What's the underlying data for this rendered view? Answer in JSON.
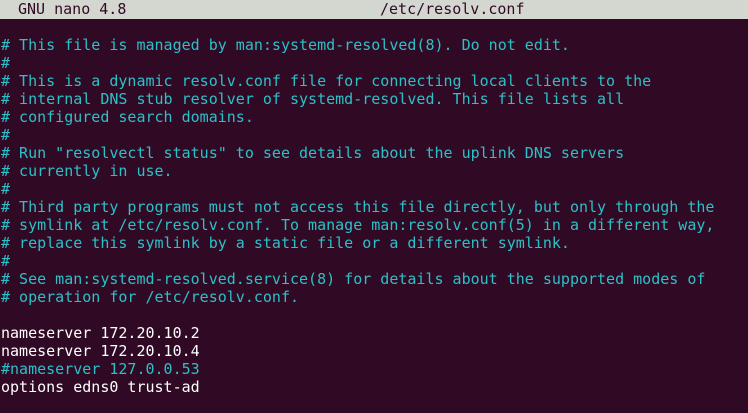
{
  "title_bar": {
    "app_name": "GNU nano 4.8",
    "file_path": "/etc/resolv.conf"
  },
  "file_lines": [
    {
      "text": "# This file is managed by man:systemd-resolved(8). Do not edit.",
      "kind": "comment"
    },
    {
      "text": "#",
      "kind": "comment"
    },
    {
      "text": "# This is a dynamic resolv.conf file for connecting local clients to the",
      "kind": "comment"
    },
    {
      "text": "# internal DNS stub resolver of systemd-resolved. This file lists all",
      "kind": "comment"
    },
    {
      "text": "# configured search domains.",
      "kind": "comment"
    },
    {
      "text": "#",
      "kind": "comment"
    },
    {
      "text": "# Run \"resolvectl status\" to see details about the uplink DNS servers",
      "kind": "comment"
    },
    {
      "text": "# currently in use.",
      "kind": "comment"
    },
    {
      "text": "#",
      "kind": "comment"
    },
    {
      "text": "# Third party programs must not access this file directly, but only through the",
      "kind": "comment"
    },
    {
      "text": "# symlink at /etc/resolv.conf. To manage man:resolv.conf(5) in a different way,",
      "kind": "comment"
    },
    {
      "text": "# replace this symlink by a static file or a different symlink.",
      "kind": "comment"
    },
    {
      "text": "#",
      "kind": "comment"
    },
    {
      "text": "# See man:systemd-resolved.service(8) for details about the supported modes of",
      "kind": "comment"
    },
    {
      "text": "# operation for /etc/resolv.conf.",
      "kind": "comment"
    },
    {
      "text": "",
      "kind": "plain"
    },
    {
      "text": "nameserver 172.20.10.2",
      "kind": "plain"
    },
    {
      "text": "nameserver 172.20.10.4",
      "kind": "plain"
    },
    {
      "text": "#nameserver 127.0.0.53",
      "kind": "comment"
    },
    {
      "text": "options edns0 trust-ad",
      "kind": "plain"
    }
  ],
  "colors": {
    "background": "#300a24",
    "title_bar": "#d3d7cf",
    "comment": "#2cc0c8",
    "text": "#ffffff"
  }
}
